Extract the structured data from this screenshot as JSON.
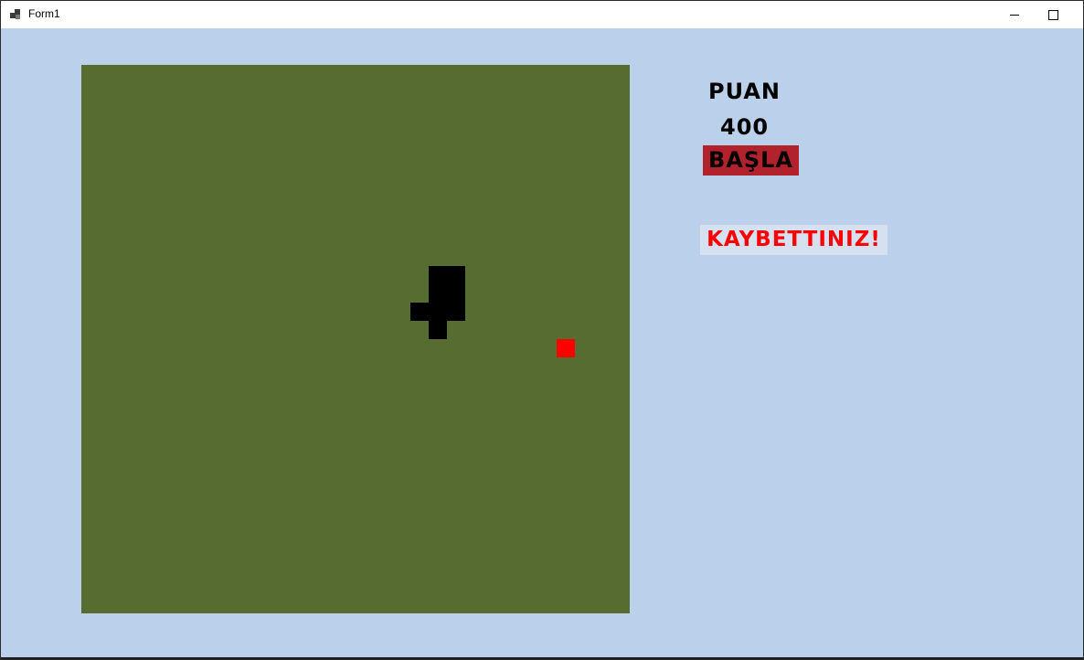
{
  "window": {
    "title": "Form1",
    "minimize_icon": "minimize-icon",
    "maximize_icon": "maximize-icon"
  },
  "colors": {
    "client_background": "#bbd0ea",
    "board": "#566c31",
    "snake": "#000000",
    "food": "#ff0000",
    "start_button": "#b2222c",
    "lost_text": "#ff0000"
  },
  "panel": {
    "score_title": "PUAN",
    "score_value": "400",
    "start_label": "BAŞLA",
    "lost_message": "KAYBETTINIZ!"
  }
}
